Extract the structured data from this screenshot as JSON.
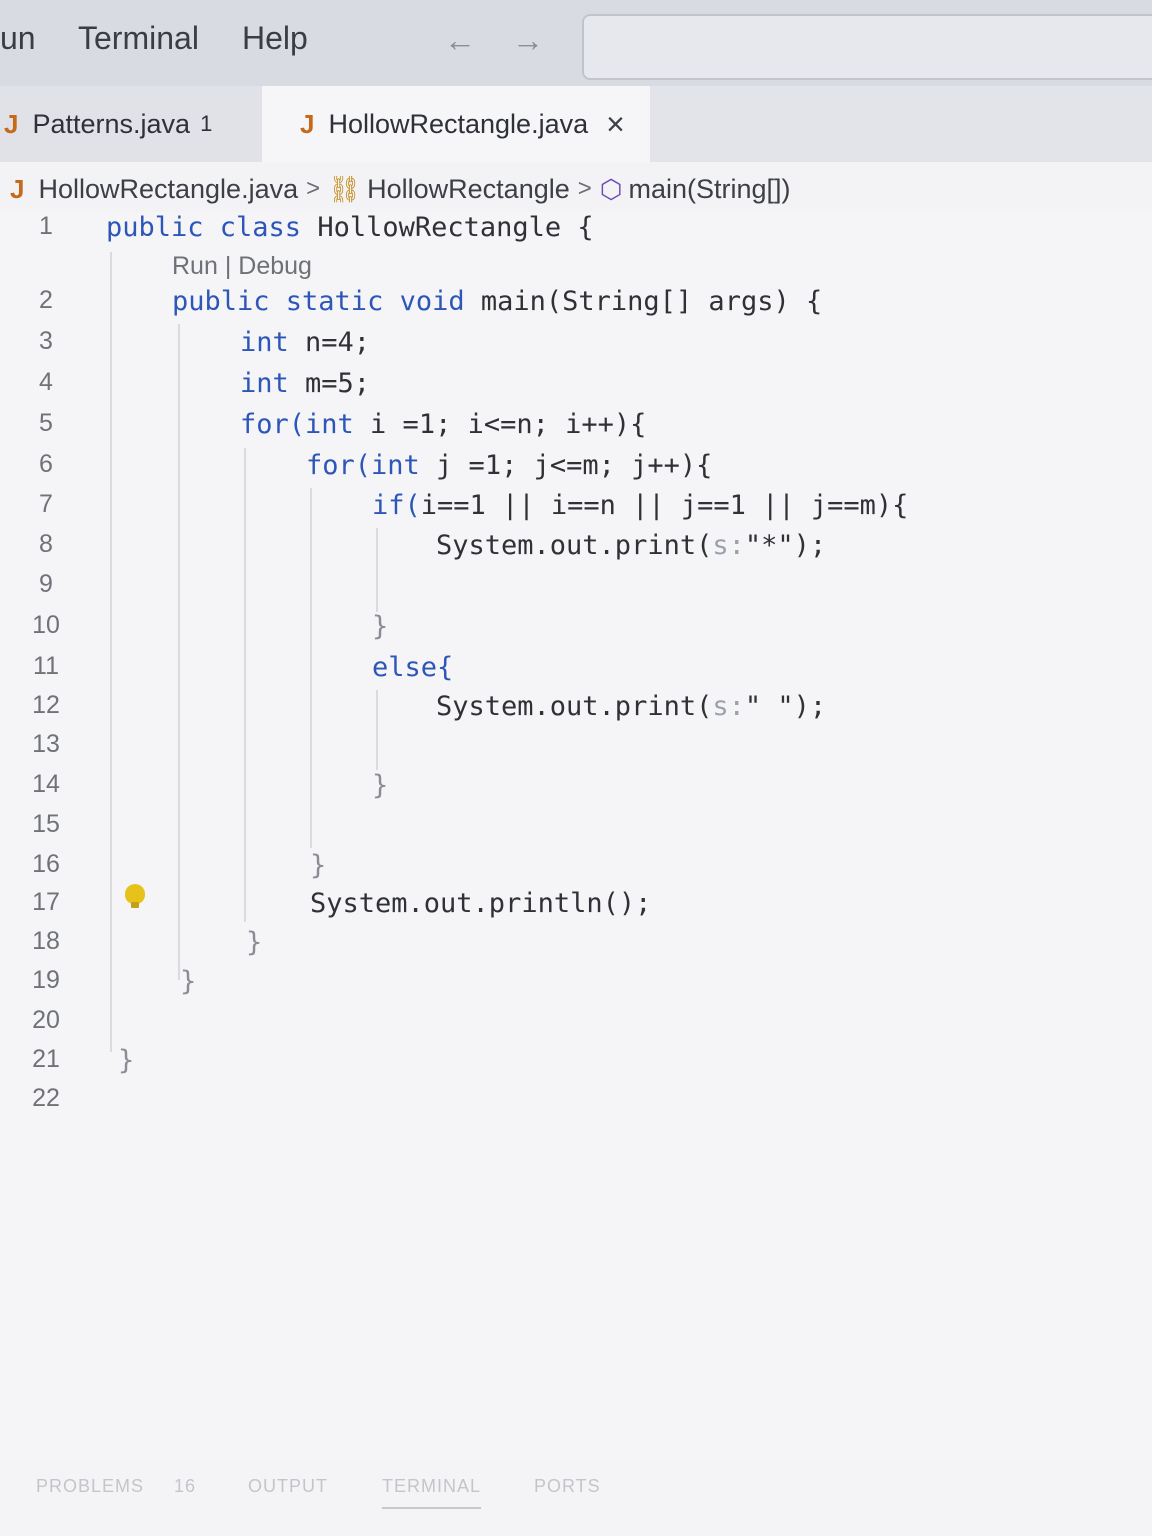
{
  "menu": {
    "items": [
      "un",
      "Terminal",
      "Help"
    ],
    "back_arrow": "←",
    "forward_arrow": "→"
  },
  "tabs": [
    {
      "label": "Patterns.java",
      "badge": "1",
      "icon": "java-file-icon"
    },
    {
      "label": "HollowRectangle.java",
      "close": "×",
      "icon": "java-file-icon",
      "active": true
    }
  ],
  "breadcrumb": {
    "file": "HollowRectangle.java",
    "class": "HollowRectangle",
    "method": "main(String[])",
    "separator": ">"
  },
  "codelens": {
    "run": "Run",
    "sep": " | ",
    "debug": "Debug"
  },
  "gutter": {
    "line_numbers": [
      "1",
      "2",
      "3",
      "4",
      "5",
      "6",
      "7",
      "8",
      "9",
      "10",
      "11",
      "12",
      "13",
      "14",
      "15",
      "16",
      "17",
      "18",
      "19",
      "20",
      "21",
      "22"
    ]
  },
  "code": {
    "l1_kw": "public class ",
    "l1_rest": "HollowRectangle {",
    "l2_kw": "public static void ",
    "l2_rest": "main(String[] args) {",
    "l3_kw": "int ",
    "l3_rest": "n=4;",
    "l4_kw": "int ",
    "l4_rest": "m=5;",
    "l5_kw": "for(int ",
    "l5_rest": "i =1; i<=n; i++){",
    "l6_kw": "for(int ",
    "l6_rest": "j =1; j<=m; j++){",
    "l7_kw": "if(",
    "l7_rest": "i==1 || i==n || j==1 || j==m){",
    "l8_pre": "System.out.print(",
    "l8_hint": "s:",
    "l8_post": "\"*\");",
    "l10": "}",
    "l11": "else{",
    "l12_pre": "System.out.print(",
    "l12_hint": "s:",
    "l12_post": "\" \");",
    "l14": "}",
    "l16": "}",
    "l17": "System.out.println();",
    "l18": "}",
    "l19": "}",
    "l21": "}"
  },
  "panel": {
    "problems": "PROBLEMS",
    "problems_count": "16",
    "output": "OUTPUT",
    "terminal": "TERMINAL",
    "ports": "PORTS"
  },
  "colors": {
    "keyword": "#2d56b8",
    "java_icon": "#c46a1a",
    "lightbulb": "#e6c21a"
  }
}
